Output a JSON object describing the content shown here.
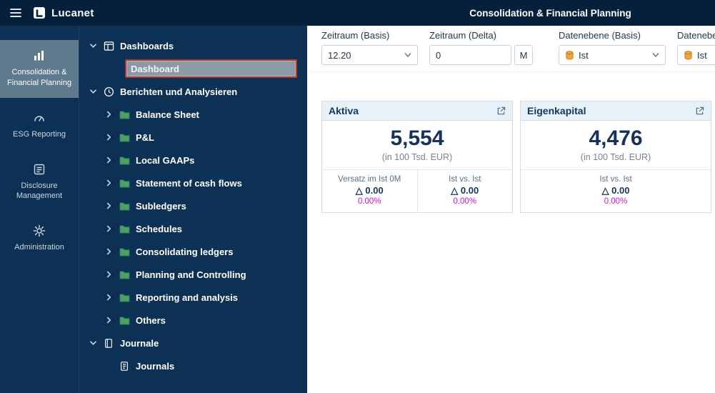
{
  "colors": {
    "topbar": "#05203a",
    "sidebar": "#0c3154",
    "accent_red": "#b5382a",
    "magenta": "#c913c9",
    "navy": "#16325c",
    "card_header": "#e7f1f8",
    "folder": "#4aa168",
    "datalevel_orange": "#f2a33c"
  },
  "topbar": {
    "menu_icon": "hamburger-icon",
    "logo_icon": "lucanet-logo-icon",
    "brand": "Lucanet",
    "title": "Consolidation & Financial Planning"
  },
  "rail": {
    "items": [
      {
        "label": "Consolidation & Financial Planning",
        "icon": "consolidation-chart-icon",
        "active": true
      },
      {
        "label": "ESG Reporting",
        "icon": "esg-gauge-icon",
        "active": false
      },
      {
        "label": "Disclosure Management",
        "icon": "disclosure-document-icon",
        "active": false
      },
      {
        "label": "Administration",
        "icon": "gear-icon",
        "active": false
      }
    ]
  },
  "tree": {
    "items": [
      {
        "label": "Dashboards",
        "level": 0,
        "icon": "dashboard-grid-icon",
        "chevron": "expanded"
      },
      {
        "label": "Dashboard",
        "level": 1,
        "selected": true
      },
      {
        "label": "Berichten und Analysieren",
        "level": 0,
        "icon": "clock-icon",
        "chevron": "expanded"
      },
      {
        "label": "Balance Sheet",
        "level": 1,
        "icon": "folder-icon",
        "chevron": "collapsed"
      },
      {
        "label": "P&L",
        "level": 1,
        "icon": "folder-icon",
        "chevron": "collapsed"
      },
      {
        "label": "Local GAAPs",
        "level": 1,
        "icon": "folder-icon",
        "chevron": "collapsed"
      },
      {
        "label": "Statement of cash flows",
        "level": 1,
        "icon": "folder-icon",
        "chevron": "collapsed"
      },
      {
        "label": "Subledgers",
        "level": 1,
        "icon": "folder-icon",
        "chevron": "collapsed"
      },
      {
        "label": "Schedules",
        "level": 1,
        "icon": "folder-icon",
        "chevron": "collapsed"
      },
      {
        "label": "Consolidating ledgers",
        "level": 1,
        "icon": "folder-icon",
        "chevron": "collapsed"
      },
      {
        "label": "Planning and Controlling",
        "level": 1,
        "icon": "folder-icon",
        "chevron": "collapsed"
      },
      {
        "label": "Reporting and analysis",
        "level": 1,
        "icon": "folder-icon",
        "chevron": "collapsed"
      },
      {
        "label": "Others",
        "level": 1,
        "icon": "folder-icon",
        "chevron": "collapsed"
      },
      {
        "label": "Journale",
        "level": 0,
        "icon": "book-icon",
        "chevron": "expanded"
      },
      {
        "label": "Journals",
        "level": 1,
        "icon": "journal-icon"
      }
    ]
  },
  "filters": {
    "groups": [
      {
        "label": "Zeitraum (Basis)",
        "type": "select",
        "value": "12.20",
        "width": "w135"
      },
      {
        "label": "Zeitraum (Delta)",
        "type": "input",
        "value": "0",
        "suffix": "M",
        "width": "w115"
      },
      {
        "label": "Datenebene (Basis)",
        "type": "select",
        "value": "Ist",
        "value_icon": "datalevel-icon",
        "width": "w150"
      },
      {
        "label": "Datenebene (Delta)",
        "type": "select",
        "value": "Ist",
        "value_icon": "datalevel-icon",
        "width": "w150"
      }
    ]
  },
  "cards": [
    {
      "title": "Aktiva",
      "action_icon": "open-external-icon",
      "value": "5,554",
      "unit": "(in 100 Tsd. EUR)",
      "metrics": [
        {
          "label": "Versatz im Ist 0M",
          "delta_symbol": "△",
          "delta": "0.00",
          "percent": "0.00%"
        },
        {
          "label": "Ist vs. Ist",
          "delta_symbol": "△",
          "delta": "0.00",
          "percent": "0.00%"
        }
      ]
    },
    {
      "title": "Eigenkapital",
      "action_icon": "open-external-icon",
      "value": "4,476",
      "unit": "(in 100 Tsd. EUR)",
      "metrics": [
        {
          "label": "Ist vs. Ist",
          "delta_symbol": "△",
          "delta": "0.00",
          "percent": "0.00%"
        }
      ]
    }
  ]
}
